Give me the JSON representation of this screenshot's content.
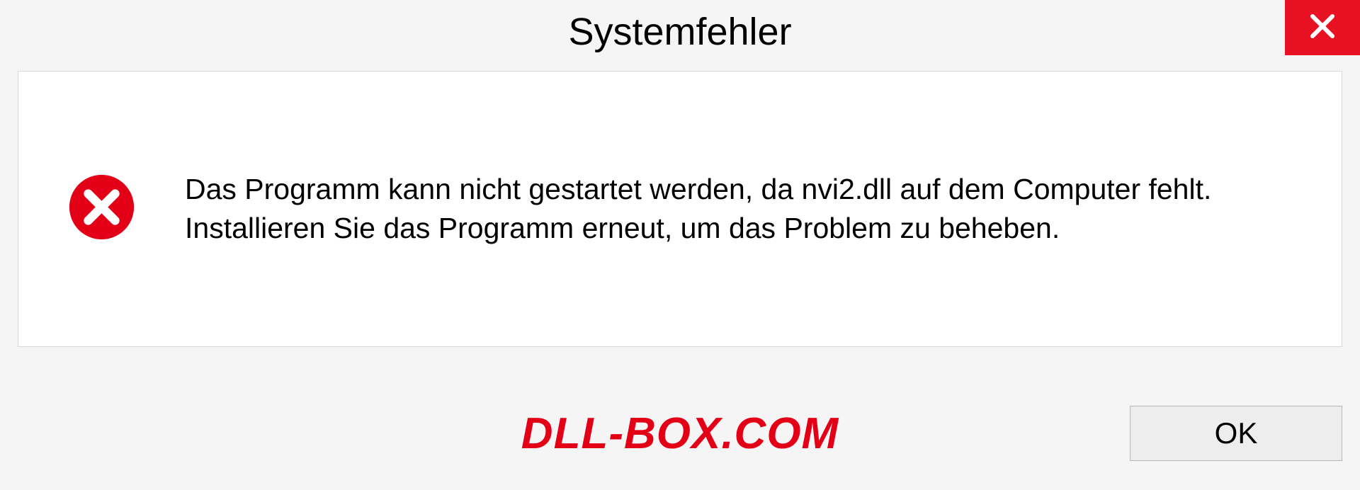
{
  "dialog": {
    "title": "Systemfehler",
    "message": "Das Programm kann nicht gestartet werden, da nvi2.dll auf dem Computer fehlt. Installieren Sie das Programm erneut, um das Problem zu beheben.",
    "ok_label": "OK"
  },
  "watermark": "DLL-BOX.COM"
}
